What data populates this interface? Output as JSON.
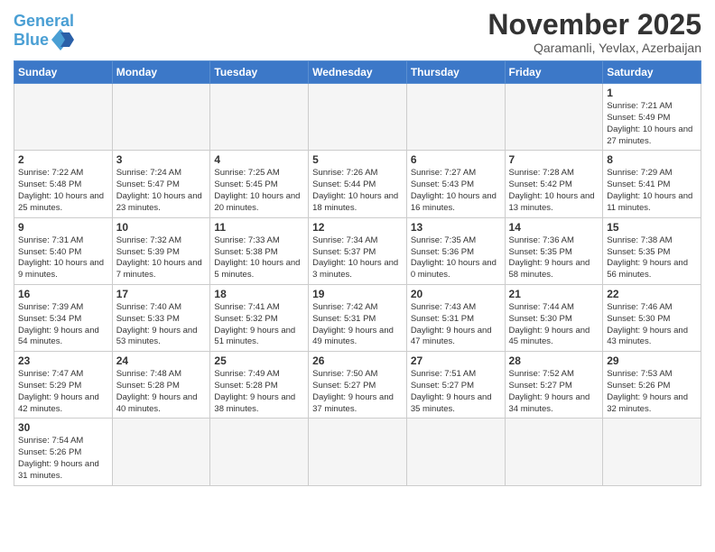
{
  "header": {
    "logo_general": "General",
    "logo_blue": "Blue",
    "month_title": "November 2025",
    "location": "Qaramanli, Yevlax, Azerbaijan"
  },
  "days_of_week": [
    "Sunday",
    "Monday",
    "Tuesday",
    "Wednesday",
    "Thursday",
    "Friday",
    "Saturday"
  ],
  "weeks": [
    [
      {
        "day": "",
        "info": ""
      },
      {
        "day": "",
        "info": ""
      },
      {
        "day": "",
        "info": ""
      },
      {
        "day": "",
        "info": ""
      },
      {
        "day": "",
        "info": ""
      },
      {
        "day": "",
        "info": ""
      },
      {
        "day": "1",
        "info": "Sunrise: 7:21 AM\nSunset: 5:49 PM\nDaylight: 10 hours and 27 minutes."
      }
    ],
    [
      {
        "day": "2",
        "info": "Sunrise: 7:22 AM\nSunset: 5:48 PM\nDaylight: 10 hours and 25 minutes."
      },
      {
        "day": "3",
        "info": "Sunrise: 7:24 AM\nSunset: 5:47 PM\nDaylight: 10 hours and 23 minutes."
      },
      {
        "day": "4",
        "info": "Sunrise: 7:25 AM\nSunset: 5:45 PM\nDaylight: 10 hours and 20 minutes."
      },
      {
        "day": "5",
        "info": "Sunrise: 7:26 AM\nSunset: 5:44 PM\nDaylight: 10 hours and 18 minutes."
      },
      {
        "day": "6",
        "info": "Sunrise: 7:27 AM\nSunset: 5:43 PM\nDaylight: 10 hours and 16 minutes."
      },
      {
        "day": "7",
        "info": "Sunrise: 7:28 AM\nSunset: 5:42 PM\nDaylight: 10 hours and 13 minutes."
      },
      {
        "day": "8",
        "info": "Sunrise: 7:29 AM\nSunset: 5:41 PM\nDaylight: 10 hours and 11 minutes."
      }
    ],
    [
      {
        "day": "9",
        "info": "Sunrise: 7:31 AM\nSunset: 5:40 PM\nDaylight: 10 hours and 9 minutes."
      },
      {
        "day": "10",
        "info": "Sunrise: 7:32 AM\nSunset: 5:39 PM\nDaylight: 10 hours and 7 minutes."
      },
      {
        "day": "11",
        "info": "Sunrise: 7:33 AM\nSunset: 5:38 PM\nDaylight: 10 hours and 5 minutes."
      },
      {
        "day": "12",
        "info": "Sunrise: 7:34 AM\nSunset: 5:37 PM\nDaylight: 10 hours and 3 minutes."
      },
      {
        "day": "13",
        "info": "Sunrise: 7:35 AM\nSunset: 5:36 PM\nDaylight: 10 hours and 0 minutes."
      },
      {
        "day": "14",
        "info": "Sunrise: 7:36 AM\nSunset: 5:35 PM\nDaylight: 9 hours and 58 minutes."
      },
      {
        "day": "15",
        "info": "Sunrise: 7:38 AM\nSunset: 5:35 PM\nDaylight: 9 hours and 56 minutes."
      }
    ],
    [
      {
        "day": "16",
        "info": "Sunrise: 7:39 AM\nSunset: 5:34 PM\nDaylight: 9 hours and 54 minutes."
      },
      {
        "day": "17",
        "info": "Sunrise: 7:40 AM\nSunset: 5:33 PM\nDaylight: 9 hours and 53 minutes."
      },
      {
        "day": "18",
        "info": "Sunrise: 7:41 AM\nSunset: 5:32 PM\nDaylight: 9 hours and 51 minutes."
      },
      {
        "day": "19",
        "info": "Sunrise: 7:42 AM\nSunset: 5:31 PM\nDaylight: 9 hours and 49 minutes."
      },
      {
        "day": "20",
        "info": "Sunrise: 7:43 AM\nSunset: 5:31 PM\nDaylight: 9 hours and 47 minutes."
      },
      {
        "day": "21",
        "info": "Sunrise: 7:44 AM\nSunset: 5:30 PM\nDaylight: 9 hours and 45 minutes."
      },
      {
        "day": "22",
        "info": "Sunrise: 7:46 AM\nSunset: 5:30 PM\nDaylight: 9 hours and 43 minutes."
      }
    ],
    [
      {
        "day": "23",
        "info": "Sunrise: 7:47 AM\nSunset: 5:29 PM\nDaylight: 9 hours and 42 minutes."
      },
      {
        "day": "24",
        "info": "Sunrise: 7:48 AM\nSunset: 5:28 PM\nDaylight: 9 hours and 40 minutes."
      },
      {
        "day": "25",
        "info": "Sunrise: 7:49 AM\nSunset: 5:28 PM\nDaylight: 9 hours and 38 minutes."
      },
      {
        "day": "26",
        "info": "Sunrise: 7:50 AM\nSunset: 5:27 PM\nDaylight: 9 hours and 37 minutes."
      },
      {
        "day": "27",
        "info": "Sunrise: 7:51 AM\nSunset: 5:27 PM\nDaylight: 9 hours and 35 minutes."
      },
      {
        "day": "28",
        "info": "Sunrise: 7:52 AM\nSunset: 5:27 PM\nDaylight: 9 hours and 34 minutes."
      },
      {
        "day": "29",
        "info": "Sunrise: 7:53 AM\nSunset: 5:26 PM\nDaylight: 9 hours and 32 minutes."
      }
    ],
    [
      {
        "day": "30",
        "info": "Sunrise: 7:54 AM\nSunset: 5:26 PM\nDaylight: 9 hours and 31 minutes."
      },
      {
        "day": "",
        "info": ""
      },
      {
        "day": "",
        "info": ""
      },
      {
        "day": "",
        "info": ""
      },
      {
        "day": "",
        "info": ""
      },
      {
        "day": "",
        "info": ""
      },
      {
        "day": "",
        "info": ""
      }
    ]
  ]
}
